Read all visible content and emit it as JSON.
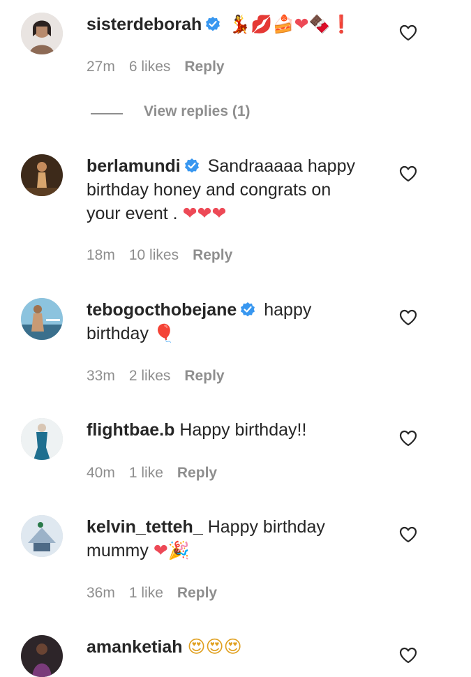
{
  "comments": [
    {
      "username": "sisterdeborah",
      "verified": true,
      "text": "",
      "emoji": "💃💋🍰❤🍫❗",
      "time": "27m",
      "likes": "6 likes",
      "reply": "Reply",
      "avatar_color": "#c9a58e"
    },
    {
      "username": "berlamundi",
      "verified": true,
      "text": "Sandraaaaa happy birthday honey and congrats on your event .",
      "emoji": "❤❤❤",
      "time": "18m",
      "likes": "10 likes",
      "reply": "Reply",
      "avatar_color": "#6b4a2a"
    },
    {
      "username": "tebogocthobejane",
      "verified": true,
      "text": "happy birthday",
      "emoji": "🎈",
      "time": "33m",
      "likes": "2 likes",
      "reply": "Reply",
      "avatar_color": "#5aa0c0"
    },
    {
      "username": "flightbae.b",
      "verified": false,
      "text": "Happy birthday!!",
      "emoji": "",
      "time": "40m",
      "likes": "1 like",
      "reply": "Reply",
      "avatar_color": "#e8eef0"
    },
    {
      "username": "kelvin_tetteh_",
      "verified": false,
      "text": "Happy birthday mummy",
      "emoji": "❤🎉",
      "time": "36m",
      "likes": "1 like",
      "reply": "Reply",
      "avatar_color": "#c7d6e6"
    },
    {
      "username": "amanketiah",
      "verified": false,
      "text": "",
      "emoji": "😍😍😍",
      "time": "",
      "likes": "",
      "reply": "",
      "avatar_color": "#3b2f33"
    }
  ],
  "view_replies": "View replies (1)",
  "colors": {
    "text": "#262626",
    "muted": "#8e8e8e",
    "verified": "#3897f0",
    "heart_red": "#ed4956"
  },
  "icons": {
    "verified": "verified-badge-icon",
    "like": "heart-outline-icon"
  }
}
